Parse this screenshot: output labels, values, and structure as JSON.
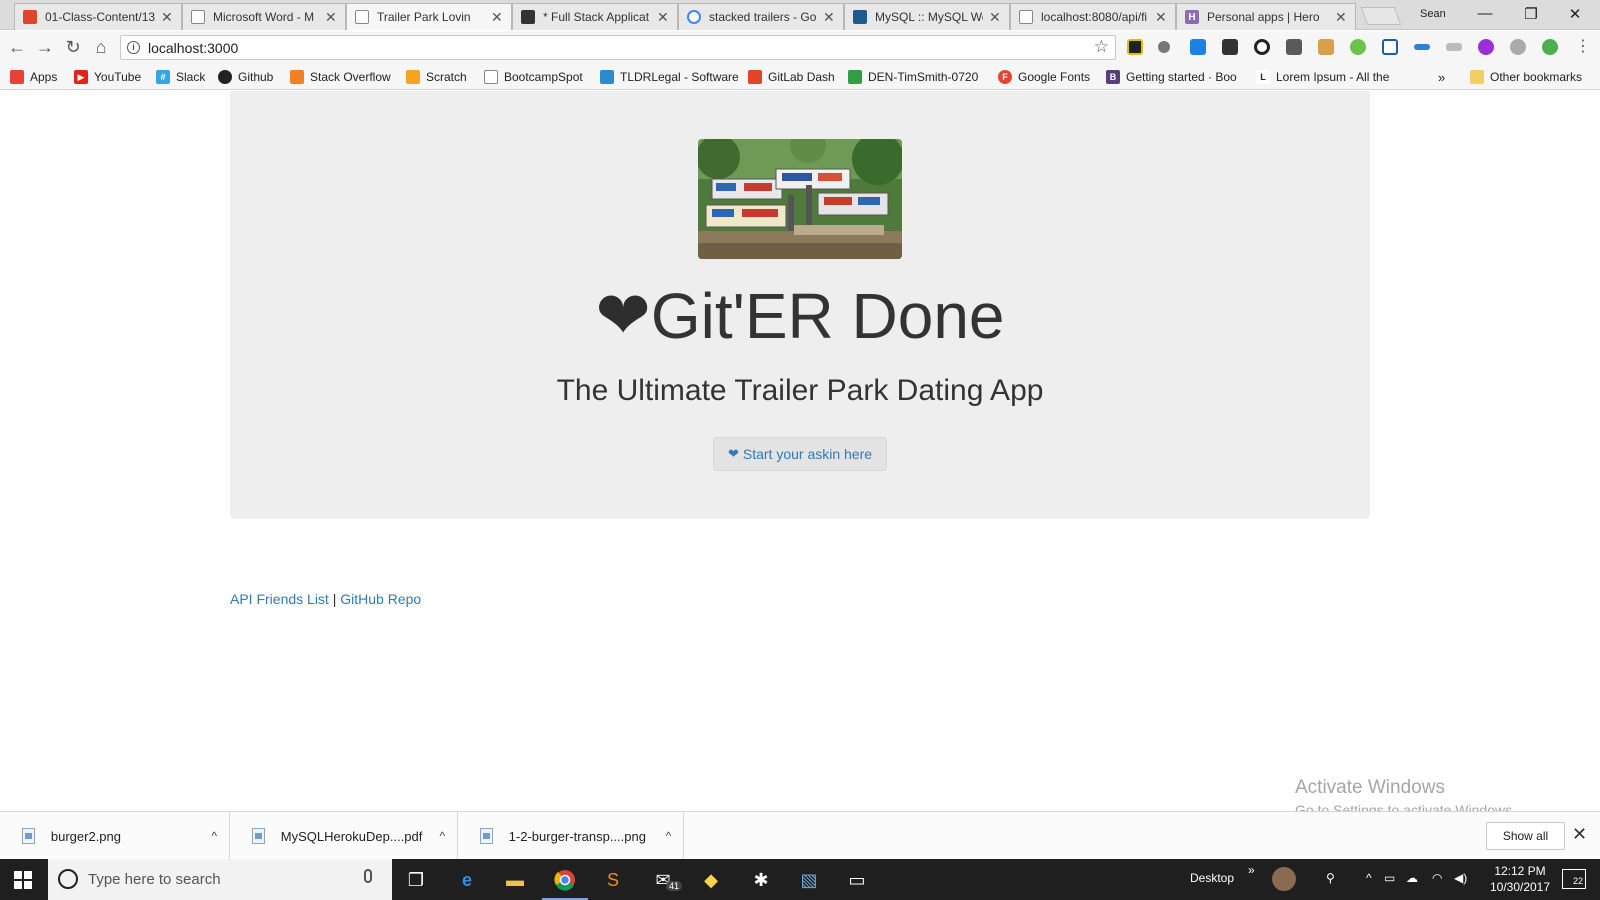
{
  "browser": {
    "tabs": [
      {
        "title": "01-Class-Content/13",
        "favicon_color": "#e2432a",
        "icon": "gitlab-icon"
      },
      {
        "title": "Microsoft Word - M",
        "favicon_color": "#ffffff",
        "icon": "document-icon"
      },
      {
        "title": "Trailer Park Lovin",
        "favicon_color": "#ffffff",
        "icon": "document-icon",
        "active": true
      },
      {
        "title": "* Full Stack Applicat",
        "favicon_color": "#333333",
        "icon": "app-icon"
      },
      {
        "title": "stacked trailers - Go",
        "favicon_color": "#4285f4",
        "icon": "google-icon"
      },
      {
        "title": "MySQL :: MySQL Wo",
        "favicon_color": "#1d5b8c",
        "icon": "mysql-icon"
      },
      {
        "title": "localhost:8080/api/fi",
        "favicon_color": "#ffffff",
        "icon": "document-icon"
      },
      {
        "title": "Personal apps | Hero",
        "favicon_color": "#8e6bb5",
        "icon": "heroku-icon"
      }
    ],
    "profile_name": "Sean",
    "window_controls": {
      "minimize": "—",
      "restore": "❐",
      "close": "✕"
    },
    "nav": {
      "back": "←",
      "forward": "→",
      "reload": "↻",
      "home": "⌂"
    },
    "address": {
      "url": "localhost:3000",
      "info_glyph": "i",
      "star_glyph": "☆"
    },
    "bookmarks": [
      {
        "label": "Apps",
        "icon": "apps-grid-icon",
        "color": "#e94235"
      },
      {
        "label": "YouTube",
        "icon": "youtube-icon",
        "color": "#e62117"
      },
      {
        "label": "Slack",
        "icon": "slack-icon",
        "color": "#3aa3e3"
      },
      {
        "label": "Github",
        "icon": "github-icon",
        "color": "#222222"
      },
      {
        "label": "Stack Overflow",
        "icon": "stackoverflow-icon",
        "color": "#f48024"
      },
      {
        "label": "Scratch",
        "icon": "scratch-icon",
        "color": "#f7a51e"
      },
      {
        "label": "BootcampSpot",
        "icon": "document-icon",
        "color": "#ffffff"
      },
      {
        "label": "TLDRLegal - Software",
        "icon": "tldr-icon",
        "color": "#2b8bd0"
      },
      {
        "label": "GitLab Dash",
        "icon": "gitlab-icon",
        "color": "#e2432a"
      },
      {
        "label": "DEN-TimSmith-0720",
        "icon": "recycle-icon",
        "color": "#2f9e44"
      },
      {
        "label": "Google Fonts",
        "icon": "google-fonts-icon",
        "color": "#e94235"
      },
      {
        "label": "Getting started · Boo",
        "icon": "bootstrap-icon",
        "color": "#563d7c"
      },
      {
        "label": "Lorem Ipsum - All the",
        "icon": "lorem-icon",
        "color": "#ffffff"
      }
    ],
    "bookmarks_overflow": "»",
    "other_bookmarks": "Other bookmarks"
  },
  "page": {
    "hero_title": "Git'ER Done",
    "heart_glyph": "❤",
    "hero_subtitle": "The Ultimate Trailer Park Dating App",
    "cta_label": "Start your askin here",
    "footer": {
      "link1": "API Friends List",
      "separator": "|",
      "link2": "GitHub Repo"
    },
    "colors": {
      "link": "#337ab7",
      "jumbotron_bg": "#eeeeee"
    }
  },
  "watermark": {
    "line1": "Activate Windows",
    "line2": "Go to Settings to activate Windows."
  },
  "downloads": {
    "items": [
      {
        "name": "burger2.png",
        "type": "image"
      },
      {
        "name": "MySQLHerokuDep....pdf",
        "type": "pdf"
      },
      {
        "name": "1-2-burger-transp....png",
        "type": "image"
      }
    ],
    "chevron_glyph": "^",
    "show_all": "Show all",
    "close_glyph": "✕"
  },
  "taskbar": {
    "search_placeholder": "Type here to search",
    "desktop_label": "Desktop",
    "desktop_chevron": "»",
    "mail_badge": "41",
    "time": "12:12 PM",
    "date": "10/30/2017",
    "notification_count": "22"
  }
}
